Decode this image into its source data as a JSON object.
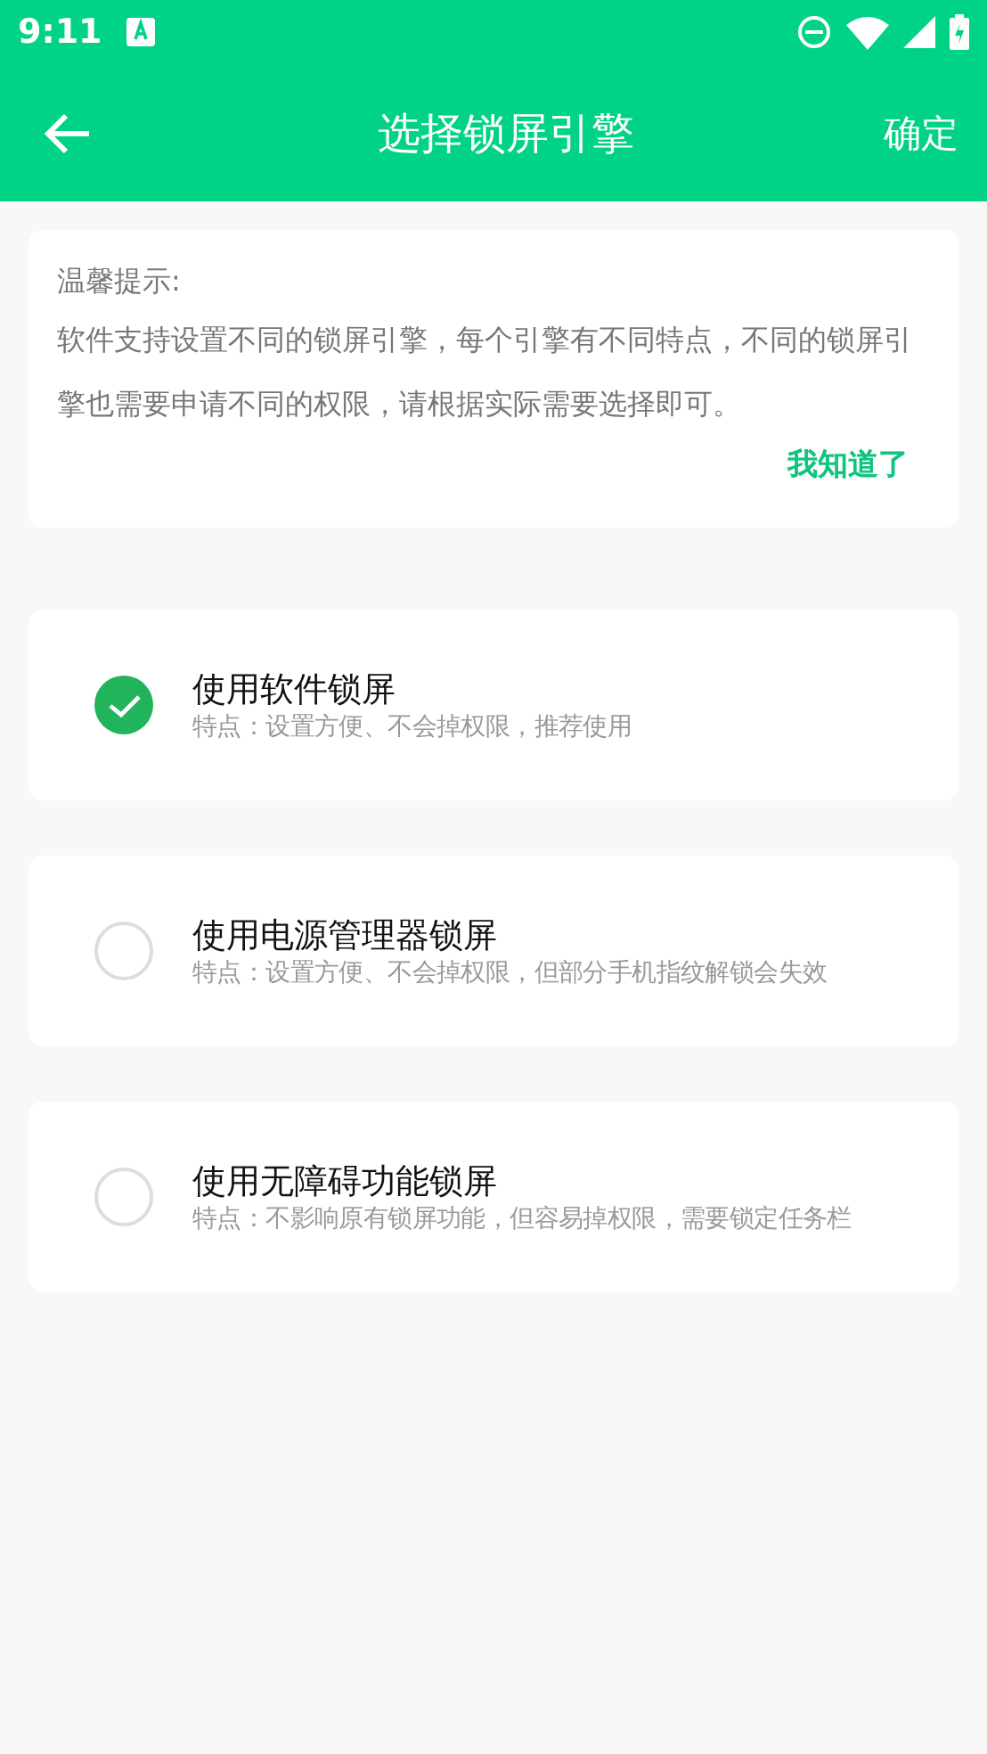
{
  "status_bar": {
    "time": "9:11"
  },
  "app_bar": {
    "title": "选择锁屏引擎",
    "action": "确定"
  },
  "tip": {
    "heading": "温馨提示:",
    "body": "软件支持设置不同的锁屏引擎，每个引擎有不同特点，不同的锁屏引擎也需要申请不同的权限，请根据实际需要选择即可。",
    "dismiss": "我知道了"
  },
  "options": [
    {
      "title": "使用软件锁屏",
      "description": "特点：设置方便、不会掉权限，推荐使用",
      "selected": true
    },
    {
      "title": "使用电源管理器锁屏",
      "description": "特点：设置方便、不会掉权限，但部分手机指纹解锁会失效",
      "selected": false
    },
    {
      "title": "使用无障碍功能锁屏",
      "description": "特点：不影响原有锁屏功能，但容易掉权限，需要锁定任务栏",
      "selected": false
    }
  ]
}
